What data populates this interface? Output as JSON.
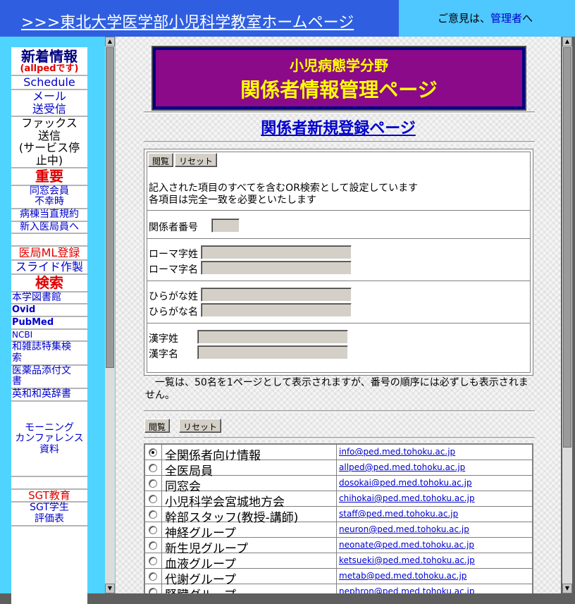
{
  "top": {
    "title": ">>>東北大学医学部小児科学教室ホームページ",
    "contact_prefix": "ご意見は、",
    "contact_link": "管理者",
    "contact_suffix": "へ"
  },
  "nav": {
    "news_heading": "新着情報",
    "news_sub": "(allpedです)",
    "schedule": "Schedule",
    "mail_1": "メール",
    "mail_2": "送受信",
    "fax_1": "ファックス",
    "fax_2": "送信",
    "fax_3": "(サービス停",
    "fax_4": "止中)",
    "important": "重要",
    "alumni_1": "同窓会員",
    "alumni_2": "不幸時",
    "ward_rule": "病棟当直規約",
    "new_members": "新入医局員へ",
    "ml_register": "医局ML登録",
    "slides": "スライド作製",
    "search_heading": "検索",
    "library": "本学図書館",
    "ovid": "Ovid",
    "pubmed": "PubMed",
    "ncbi": "NCBI",
    "jp_journals_1": "和雑誌特集検",
    "jp_journals_2": "索",
    "drug_inserts_1": "医薬品添付文",
    "drug_inserts_2": "書",
    "dictionary": "英和和英辞書",
    "conference_1": "モーニング",
    "conference_2": "カンファレンス",
    "conference_3": "資料",
    "sgt": "SGT教育",
    "sgt_eval_1": "SGT学生",
    "sgt_eval_2": "評価表"
  },
  "header": {
    "subtitle": "小児病態学分野",
    "title": "関係者情報管理ページ"
  },
  "page_heading": "関係者新規登録ページ",
  "form": {
    "view_button": "閲覧",
    "reset_button": "リセット",
    "instruction_1": "記入された項目のすべてを含むOR検索として設定しています",
    "instruction_2": "各項目は完全一致を必要といたします",
    "member_no_label": "関係者番号",
    "roman_last_label": "ローマ字姓",
    "roman_first_label": "ローマ字名",
    "hira_last_label": "ひらがな姓",
    "hira_first_label": "ひらがな名",
    "kanji_last_label": "漢字姓",
    "kanji_first_label": "漢字名"
  },
  "note": "一覧は、50名を1ページとして表示されますが、番号の順序には必ずしも表示されません。",
  "list_buttons": {
    "view_button": "閲覧",
    "reset_button": "リセット"
  },
  "groups": [
    {
      "name": "全関係者向け情報",
      "email": "info@ped.med.tohoku.ac.jp",
      "selected": true
    },
    {
      "name": "全医局員",
      "email": "allped@ped.med.tohoku.ac.jp",
      "selected": false
    },
    {
      "name": "同窓会",
      "email": "dosokai@ped.med.tohoku.ac.jp",
      "selected": false
    },
    {
      "name": "小児科学会宮城地方会",
      "email": "chihokai@ped.med.tohoku.ac.jp",
      "selected": false
    },
    {
      "name": "幹部スタッフ(教授-講師)",
      "email": "staff@ped.med.tohoku.ac.jp",
      "selected": false
    },
    {
      "name": "神経グループ",
      "email": "neuron@ped.med.tohoku.ac.jp",
      "selected": false
    },
    {
      "name": "新生児グループ",
      "email": "neonate@ped.med.tohoku.ac.jp",
      "selected": false
    },
    {
      "name": "血液グループ",
      "email": "ketsueki@ped.med.tohoku.ac.jp",
      "selected": false
    },
    {
      "name": "代謝グループ",
      "email": "metab@ped.med.tohoku.ac.jp",
      "selected": false
    },
    {
      "name": "腎臓グループ",
      "email": "nephron@ped.med.tohoku.ac.jp",
      "selected": false
    }
  ]
}
